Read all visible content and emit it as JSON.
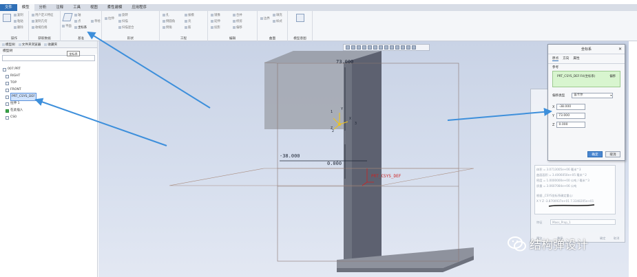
{
  "ribbon": {
    "tabs": [
      "文件",
      "模型",
      "分析",
      "注释",
      "工具",
      "视图",
      "柔性建模",
      "应用程序"
    ],
    "groups": [
      "操作",
      "获取数据",
      "基准",
      "形状",
      "工程",
      "编辑",
      "曲面",
      "模型意图"
    ],
    "csys_button": "坐标系",
    "plane_button": "平面",
    "sketch_button": "草绘"
  },
  "left_panel": {
    "tabs": [
      "模型树",
      "文件夹浏览器",
      "收藏夹"
    ],
    "title": "模型树",
    "tooltip": "坐标系",
    "tree": [
      {
        "label": "007.PRT",
        "indent": false,
        "selected": false
      },
      {
        "label": "RIGHT",
        "indent": true,
        "selected": false
      },
      {
        "label": "TOP",
        "indent": true,
        "selected": false
      },
      {
        "label": "FRONT",
        "indent": true,
        "selected": false
      },
      {
        "label": "PRT_CSYS_DEF",
        "indent": true,
        "selected": true
      },
      {
        "label": "拉伸 1",
        "indent": true,
        "selected": false
      },
      {
        "label": "在此插入",
        "indent": true,
        "selected": false
      },
      {
        "label": "CS0",
        "indent": true,
        "selected": false
      }
    ]
  },
  "viewport": {
    "dim_top": "73.000",
    "dim_left": "-38.000",
    "dim_zero": "0.000",
    "axis_x": "X",
    "axis_y": "Y",
    "axis_z": "Z",
    "axis_label_1": "1",
    "axis_label_2": "2",
    "axis_label_3": "3",
    "csys_label": "PRT_CSYS_DEF",
    "colors": {
      "model_dark": "#5e6270",
      "model_light": "#9ea3af",
      "arrow": "#3d8fdb"
    }
  },
  "dialog": {
    "title": "坐标系",
    "tabs": [
      "原点",
      "方向",
      "属性"
    ],
    "reference_label": "参考",
    "reference_item": "PRT_CSYS_DEF:F4(坐标系)",
    "reference_action": "偏移",
    "offset_type_label": "偏移类型",
    "offset_type_value": "笛卡尔",
    "x_label": "X",
    "x_value": "-38.000",
    "y_label": "Y",
    "y_value": "73.000",
    "z_label": "Z",
    "z_value": "0.000",
    "ok": "确定",
    "cancel": "取消"
  },
  "bg_dialog": {
    "line1": "体积 = 3.0713005e+06 毫米^3",
    "line2": "曲面面积 = 3.4006050e+05 毫米^2",
    "line3": "密度 = 1.0000000e+00 公吨 / 毫米^3",
    "line4": "质量 = 3.0607084e+06 公吨",
    "line5": "根据 _CSYS坐标系确定重心:",
    "line6": "X  Y  Z  -3.8700937e+01  7.3348205e+01",
    "feature_label": "特征",
    "feature_value": "Mass_Prop_1",
    "btn_preview": "预览",
    "btn_repeat": "重复",
    "btn_ok": "确定",
    "btn_cancel": "取消"
  },
  "watermark": "结构弹设计"
}
